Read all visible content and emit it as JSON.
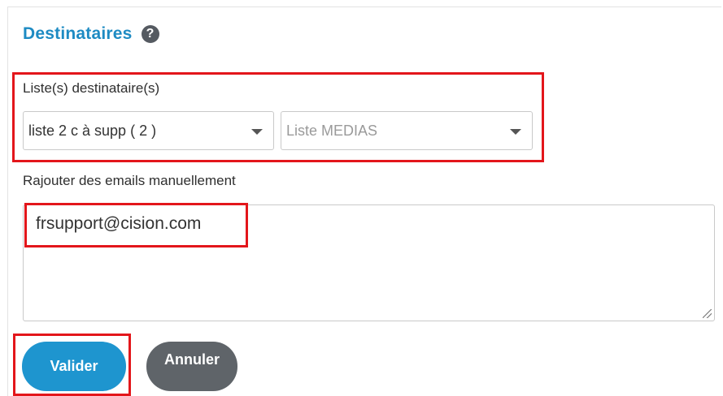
{
  "section": {
    "title": "Destinataires",
    "help_glyph": "?"
  },
  "recipients": {
    "label": "Liste(s) destinataire(s)",
    "list_select_value": "liste 2  c à supp ( 2 )",
    "media_select_placeholder": "Liste MEDIAS"
  },
  "manual_emails": {
    "label": "Rajouter des emails manuellement",
    "value": "frsupport@cision.com"
  },
  "actions": {
    "validate_label": "Valider",
    "cancel_label": "Annuler"
  },
  "colors": {
    "accent": "#1e8bc3",
    "primary_button": "#1e95cf",
    "secondary_button": "#5f6469",
    "highlight": "#e3161b"
  }
}
